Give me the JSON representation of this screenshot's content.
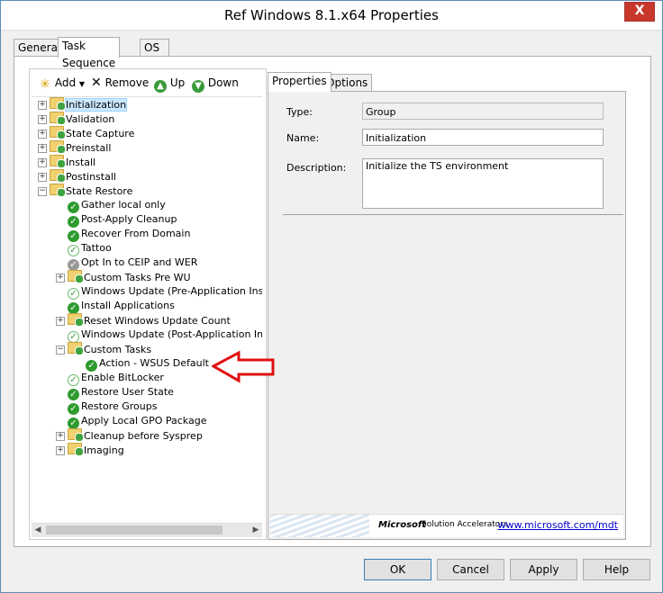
{
  "window": {
    "title": "Ref Windows 8.1.x64 Properties",
    "close": "X"
  },
  "tabs": [
    {
      "label": "General"
    },
    {
      "label": "Task Sequence"
    },
    {
      "label": "OS Info"
    }
  ],
  "toolbar": {
    "add": "Add",
    "remove": "Remove",
    "up": "Up",
    "down": "Down"
  },
  "tree": [
    {
      "label": "Initialization"
    },
    {
      "label": "Validation"
    },
    {
      "label": "State Capture"
    },
    {
      "label": "Preinstall"
    },
    {
      "label": "Install"
    },
    {
      "label": "Postinstall"
    },
    {
      "label": "State Restore"
    },
    {
      "label": "Gather local only"
    },
    {
      "label": "Post-Apply Cleanup"
    },
    {
      "label": "Recover From Domain"
    },
    {
      "label": "Tattoo"
    },
    {
      "label": "Opt In to CEIP and WER"
    },
    {
      "label": "Custom Tasks Pre WU"
    },
    {
      "label": "Windows Update (Pre-Application Installation)"
    },
    {
      "label": "Install Applications"
    },
    {
      "label": "Reset Windows Update Count"
    },
    {
      "label": "Windows Update (Post-Application Installation)"
    },
    {
      "label": "Custom Tasks"
    },
    {
      "label": "Action - WSUS Default"
    },
    {
      "label": "Enable BitLocker"
    },
    {
      "label": "Restore User State"
    },
    {
      "label": "Restore Groups"
    },
    {
      "label": "Apply Local GPO Package"
    },
    {
      "label": "Cleanup before Sysprep"
    },
    {
      "label": "Imaging"
    }
  ],
  "properties_tabs": [
    {
      "label": "Properties"
    },
    {
      "label": "Options"
    }
  ],
  "properties": {
    "type_label": "Type:",
    "type_value": "Group",
    "name_label": "Name:",
    "name_value": "Initialization",
    "description_label": "Description:",
    "description_value": "Initialize the TS environment"
  },
  "banner": {
    "brand": "Microsoft",
    "product": "Solution Accelerators",
    "link": "www.microsoft.com/mdt"
  },
  "buttons": {
    "ok": "OK",
    "cancel": "Cancel",
    "apply": "Apply",
    "help": "Help"
  }
}
